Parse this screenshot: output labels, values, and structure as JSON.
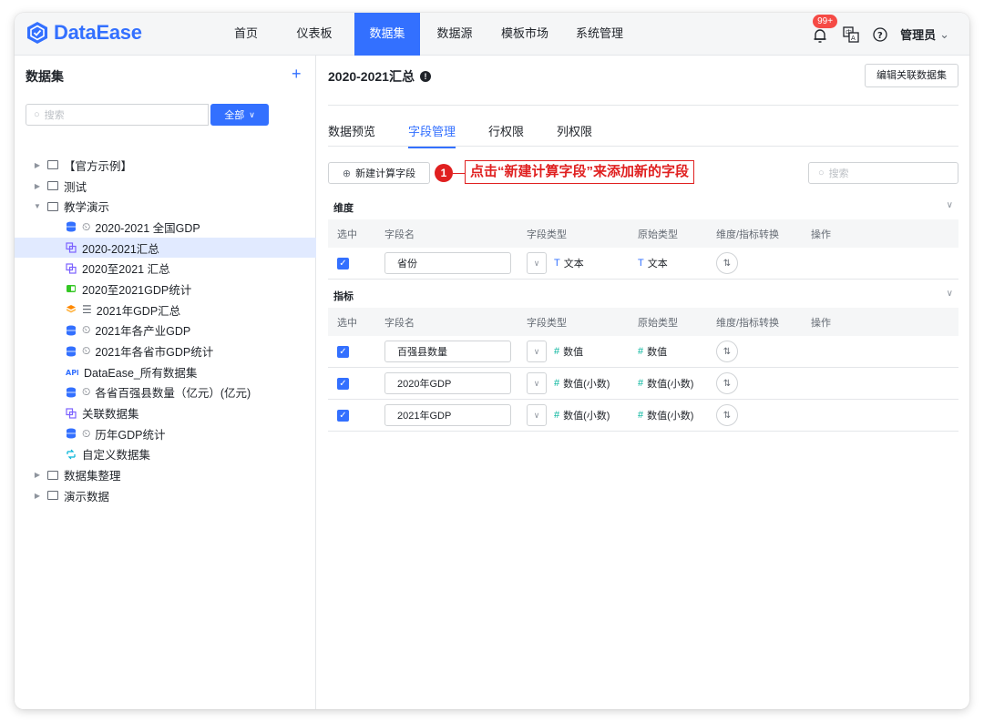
{
  "app": {
    "logo_text": "DataEase",
    "nav": [
      {
        "label": "首页",
        "active": false
      },
      {
        "label": "仪表板",
        "active": false
      },
      {
        "label": "数据集",
        "active": true
      },
      {
        "label": "数据源",
        "active": false
      },
      {
        "label": "模板市场",
        "active": false
      },
      {
        "label": "系统管理",
        "active": false
      }
    ],
    "notification_badge": "99+",
    "user_name": "管理员",
    "colors": {
      "accent": "#3370ff",
      "callout": "#e02020",
      "numeric": "#04b49c"
    }
  },
  "sidebar": {
    "title": "数据集",
    "add_icon": "plus-icon",
    "search_placeholder": "搜索",
    "filter_label": "全部",
    "tree": [
      {
        "label": "【官方示例】",
        "kind": "folder",
        "indent": 0,
        "expanded": false
      },
      {
        "label": "测试",
        "kind": "folder",
        "indent": 0,
        "expanded": false
      },
      {
        "label": "教学演示",
        "kind": "folder",
        "indent": 0,
        "expanded": true
      },
      {
        "label": "2020-2021 全国GDP",
        "kind": "db",
        "indent": 1,
        "clock": true
      },
      {
        "label": "2020-2021汇总",
        "kind": "union",
        "indent": 1,
        "clock": false,
        "selected": true
      },
      {
        "label": "2020至2021 汇总",
        "kind": "union",
        "indent": 1,
        "clock": false
      },
      {
        "label": "2020至2021GDP统计",
        "kind": "excel",
        "indent": 1,
        "clock": false
      },
      {
        "label": "2021年GDP汇总",
        "kind": "sql",
        "indent": 1,
        "clock": false,
        "prefix": "☰"
      },
      {
        "label": "2021年各产业GDP",
        "kind": "db",
        "indent": 1,
        "clock": true
      },
      {
        "label": "2021年各省市GDP统计",
        "kind": "db",
        "indent": 1,
        "clock": true
      },
      {
        "label": "DataEase_所有数据集",
        "kind": "api",
        "indent": 1,
        "clock": false
      },
      {
        "label": "各省百强县数量（亿元）(亿元)",
        "kind": "db",
        "indent": 1,
        "clock": true
      },
      {
        "label": "关联数据集",
        "kind": "union",
        "indent": 1,
        "clock": false
      },
      {
        "label": "历年GDP统计",
        "kind": "db",
        "indent": 1,
        "clock": true
      },
      {
        "label": "自定义数据集",
        "kind": "custom",
        "indent": 1,
        "clock": false
      },
      {
        "label": "数据集整理",
        "kind": "folder",
        "indent": 0,
        "expanded": false
      },
      {
        "label": "演示数据",
        "kind": "folder",
        "indent": 0,
        "expanded": false
      }
    ]
  },
  "main": {
    "title": "2020-2021汇总",
    "edit_button": "编辑关联数据集",
    "tabs": [
      {
        "label": "数据预览",
        "active": false
      },
      {
        "label": "字段管理",
        "active": true
      },
      {
        "label": "行权限",
        "active": false
      },
      {
        "label": "列权限",
        "active": false
      }
    ],
    "new_field_button": "新建计算字段",
    "callout_number": "1",
    "callout_text": "点击“新建计算字段”来添加新的字段",
    "search_placeholder": "搜索",
    "columns": {
      "select": "选中",
      "name": "字段名",
      "type": "字段类型",
      "origin": "原始类型",
      "convert": "维度/指标转换",
      "op": "操作"
    },
    "dimension_section": {
      "label": "维度",
      "rows": [
        {
          "name": "省份",
          "type": "文本",
          "type_icon": "T",
          "origin": "文本",
          "origin_icon": "T",
          "checked": true
        }
      ]
    },
    "measure_section": {
      "label": "指标",
      "rows": [
        {
          "name": "百强县数量",
          "type": "数值",
          "type_icon": "#",
          "origin": "数值",
          "origin_icon": "#",
          "checked": true
        },
        {
          "name": "2020年GDP",
          "type": "数值(小数)",
          "type_icon": "#",
          "origin": "数值(小数)",
          "origin_icon": "#",
          "checked": true
        },
        {
          "name": "2021年GDP",
          "type": "数值(小数)",
          "type_icon": "#",
          "origin": "数值(小数)",
          "origin_icon": "#",
          "checked": true
        }
      ]
    }
  }
}
